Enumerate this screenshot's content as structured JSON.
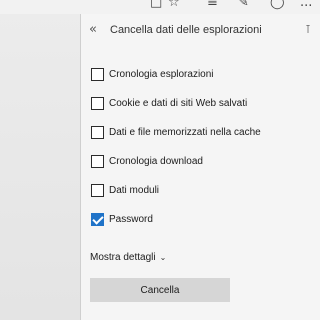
{
  "toolbar": {
    "icons": [
      "reading-view-icon",
      "favorite-star-icon",
      "hub-icon",
      "web-note-icon",
      "share-icon",
      "more-icon"
    ],
    "more_label": "..."
  },
  "flyout": {
    "title": "Cancella dati delle esplorazioni",
    "options": [
      {
        "label": "Cronologia esplorazioni",
        "checked": false
      },
      {
        "label": "Cookie e dati di siti Web salvati",
        "checked": false
      },
      {
        "label": "Dati e file memorizzati nella cache",
        "checked": false
      },
      {
        "label": "Cronologia download",
        "checked": false
      },
      {
        "label": "Dati moduli",
        "checked": false
      },
      {
        "label": "Password",
        "checked": true
      }
    ],
    "more_details_label": "Mostra dettagli",
    "clear_button_label": "Cancella"
  },
  "colors": {
    "accent": "#1f73c8",
    "panel_bg": "#f5f5f5",
    "button_bg": "#d6d6d6"
  }
}
